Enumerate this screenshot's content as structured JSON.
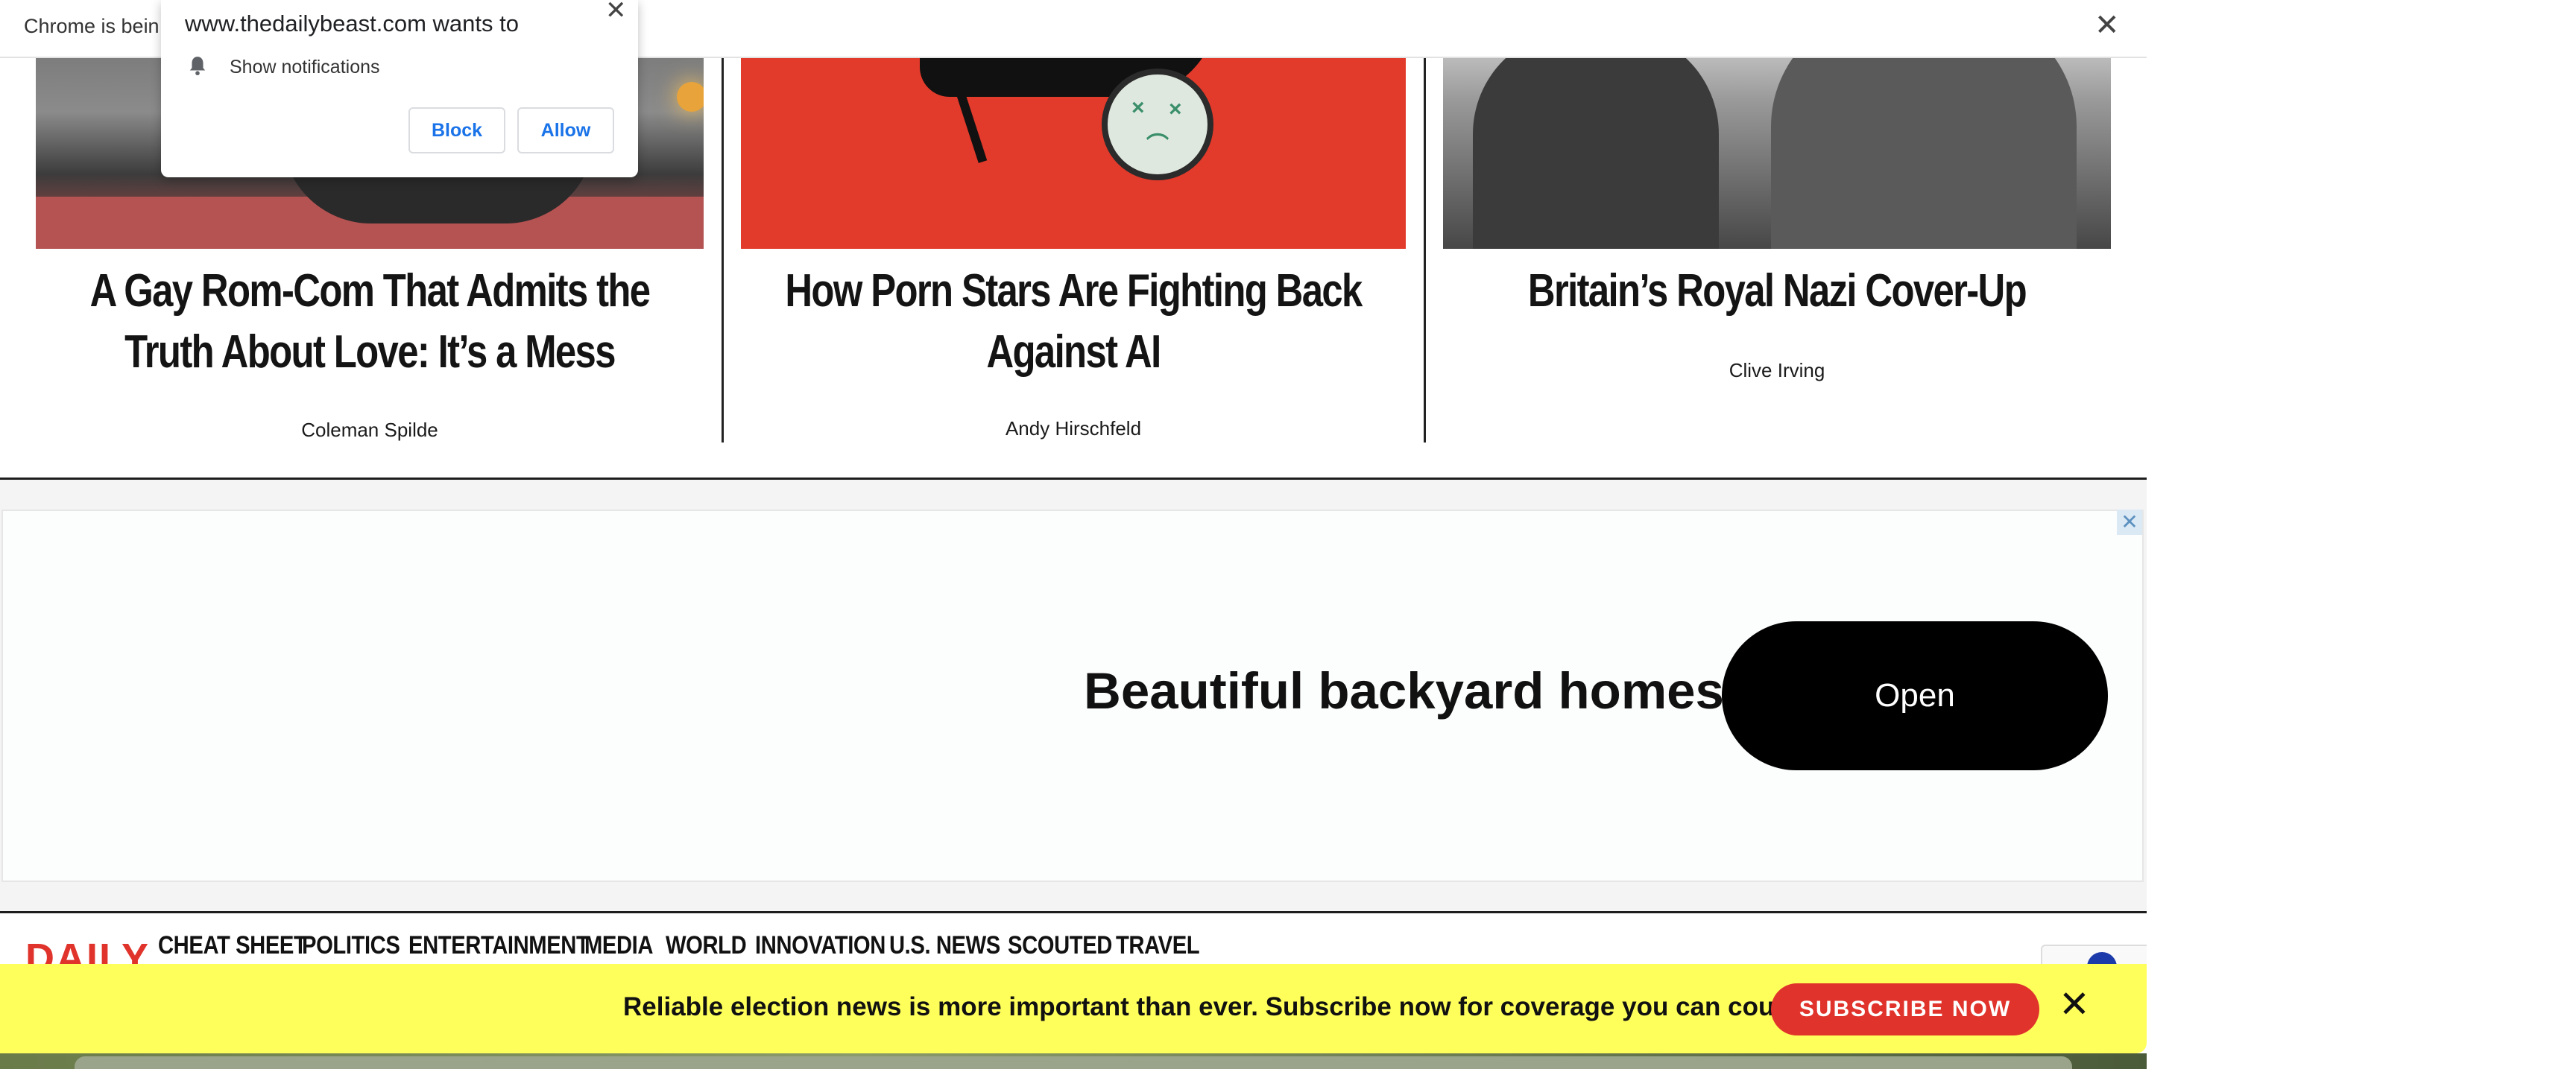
{
  "chrome_infobar": {
    "message": "Chrome is bein",
    "close_glyph": "✕"
  },
  "notification_popup": {
    "title": "www.thedailybeast.com wants to",
    "close_glyph": "✕",
    "permission": "Show notifications",
    "block_label": "Block",
    "allow_label": "Allow",
    "icon": "bell-icon"
  },
  "articles": [
    {
      "headline": "A Gay Rom-Com That Admits the Truth About Love: It’s a Mess",
      "byline": "Coleman Spilde"
    },
    {
      "headline": "How Porn Stars Are Fighting Back Against AI",
      "byline": "Andy Hirschfeld"
    },
    {
      "headline": "Britain’s Royal Nazi Cover-Up",
      "byline": "Clive Irving"
    }
  ],
  "ad": {
    "tagline": "Beautiful backyard homes",
    "button": "Open",
    "close_glyph": "✕"
  },
  "nav": {
    "logo": "DAILY",
    "items": [
      "CHEAT SHEET",
      "POLITICS",
      "ENTERTAINMENT",
      "MEDIA",
      "WORLD",
      "INNOVATION",
      "U.S. NEWS",
      "SCOUTED",
      "TRAVEL"
    ]
  },
  "subscribe_banner": {
    "message": "Reliable election news is more important than ever. Subscribe now for coverage you can count on.",
    "button": "SUBSCRIBE NOW",
    "close_glyph": "✕"
  },
  "colors": {
    "brand_red": "#e0332b",
    "banner_yellow": "#ffff5c",
    "link_blue": "#1a73e8"
  }
}
